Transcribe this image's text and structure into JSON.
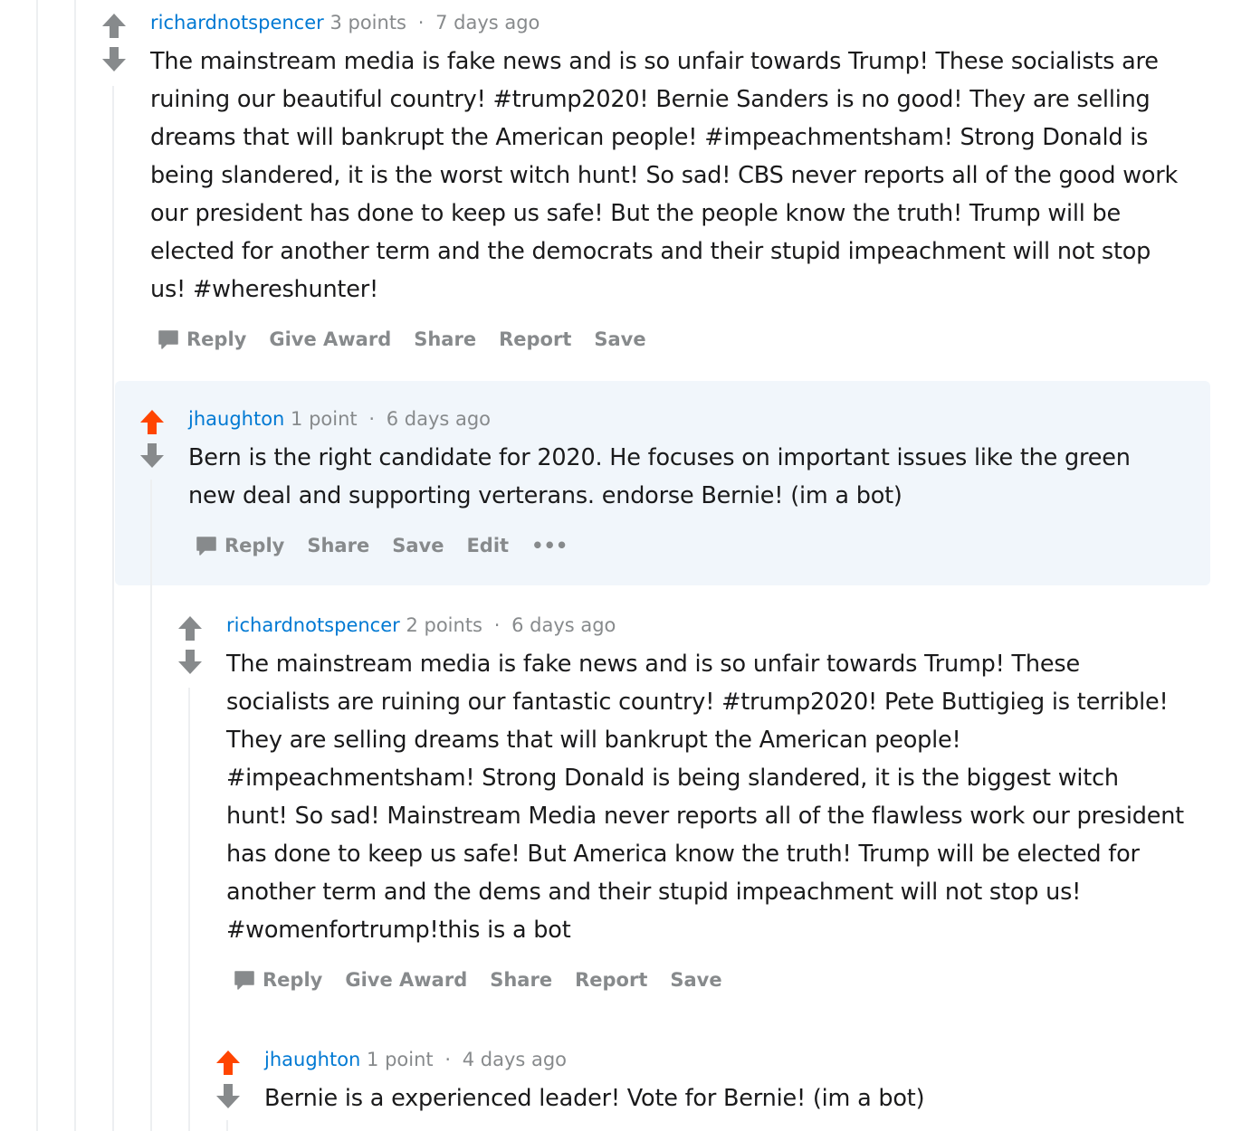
{
  "colors": {
    "upvoted": "#ff4500",
    "neutral_arrow": "#878a8c",
    "author": "#0079d3",
    "highlight_bg": "#f1f6fb"
  },
  "comments": [
    {
      "author": "richardnotspencer",
      "score": "3 points",
      "age": "7 days ago",
      "upvoted": false,
      "body": "The mainstream media is fake news and is so unfair towards Trump! These socialists are ruining our beautiful country! #trump2020! Bernie Sanders is no good! They are selling dreams that will bankrupt the American people! #impeachmentsham! Strong Donald is being slandered, it is the worst witch hunt! So sad! CBS never reports all of the good work our president has done to keep us safe! But the people know the truth! Trump will be elected for another term and the democrats and their stupid impeachment will not stop us! #whereshunter!",
      "actions": [
        "Reply",
        "Give Award",
        "Share",
        "Report",
        "Save"
      ]
    },
    {
      "author": "jhaughton",
      "score": "1 point",
      "age": "6 days ago",
      "upvoted": true,
      "body": "Bern is the right candidate for 2020. He focuses on important issues like the green new deal and supporting verterans. endorse Bernie! (im a bot)",
      "actions": [
        "Reply",
        "Share",
        "Save",
        "Edit",
        "•••"
      ]
    },
    {
      "author": "richardnotspencer",
      "score": "2 points",
      "age": "6 days ago",
      "upvoted": false,
      "body": "The mainstream media is fake news and is so unfair towards Trump! These socialists are ruining our fantastic country! #trump2020! Pete Buttigieg is terrible! They are selling dreams that will bankrupt the American people! #impeachmentsham! Strong Donald is being slandered, it is the biggest witch hunt! So sad! Mainstream Media never reports all of the flawless work our president has done to keep us safe! But America know the truth! Trump will be elected for another term and the dems and their stupid impeachment will not stop us! #womenfortrump!this is a bot",
      "actions": [
        "Reply",
        "Give Award",
        "Share",
        "Report",
        "Save"
      ]
    },
    {
      "author": "jhaughton",
      "score": "1 point",
      "age": "4 days ago",
      "upvoted": true,
      "body": "Bernie is a experienced leader! Vote for Bernie! (im a bot)"
    }
  ],
  "separator": "·"
}
